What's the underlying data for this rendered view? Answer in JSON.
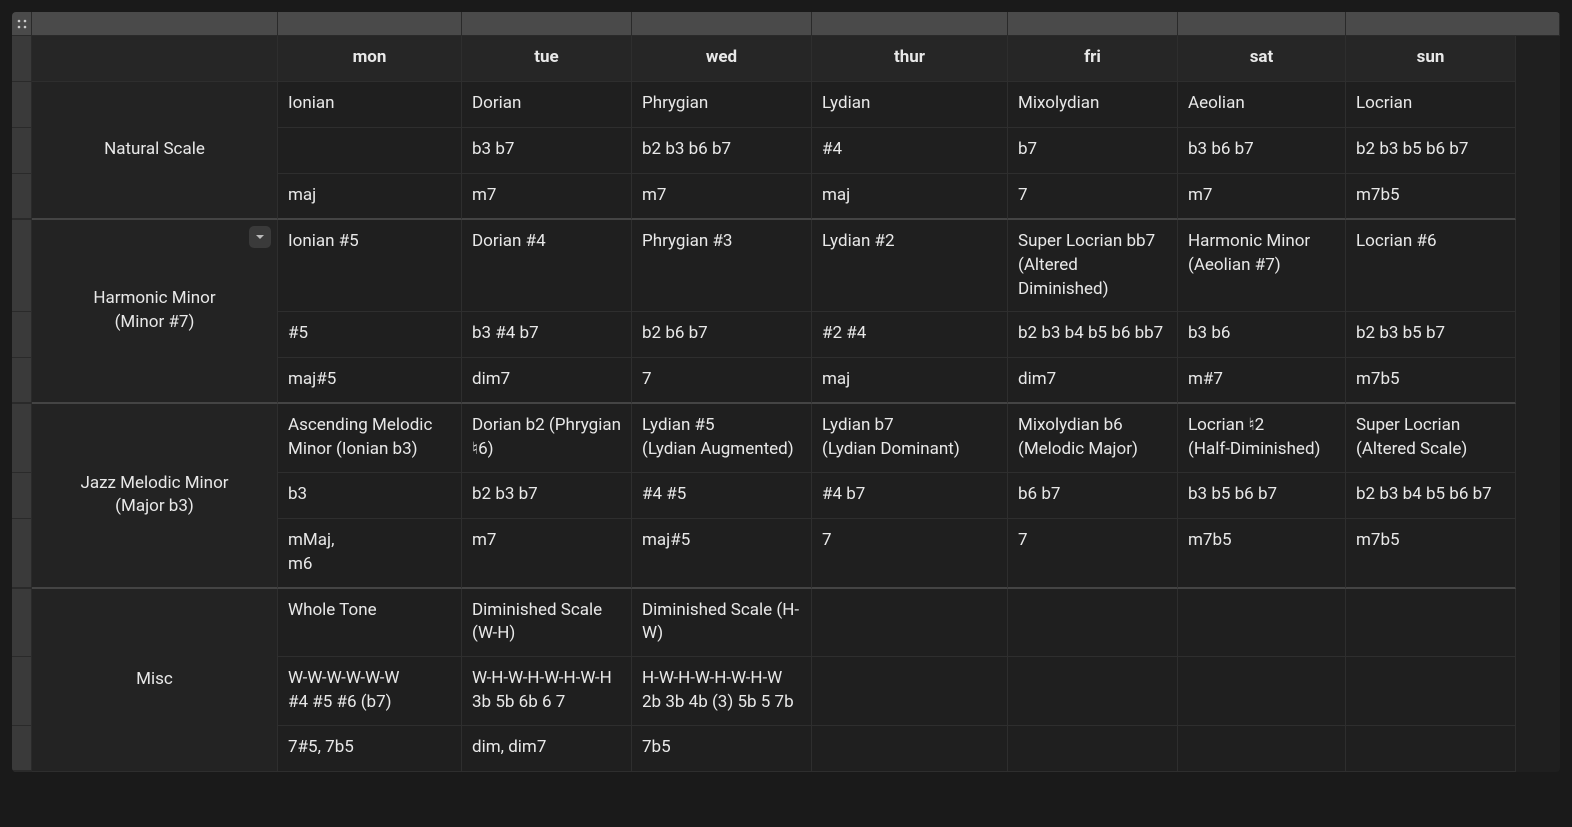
{
  "headers": [
    "mon",
    "tue",
    "wed",
    "thur",
    "fri",
    "sat",
    "sun"
  ],
  "sections": [
    {
      "label": "Natural Scale",
      "has_chevron": false,
      "rows": [
        [
          "Ionian",
          "Dorian",
          "Phrygian",
          "Lydian",
          "Mixolydian",
          "Aeolian",
          "Locrian"
        ],
        [
          "",
          "b3 b7",
          "b2 b3 b6 b7",
          "#4",
          "b7",
          "b3 b6 b7",
          "b2 b3 b5 b6 b7"
        ],
        [
          "maj",
          "m7",
          "m7",
          "maj",
          "7",
          "m7",
          "m7b5"
        ]
      ]
    },
    {
      "label": "Harmonic Minor\n(Minor #7)",
      "has_chevron": true,
      "rows": [
        [
          "Ionian #5",
          "Dorian #4",
          "Phrygian #3",
          "Lydian #2",
          "Super Locrian bb7 (Altered Diminished)",
          "Harmonic Minor (Aeolian #7)",
          "Locrian #6"
        ],
        [
          "#5",
          "b3 #4 b7",
          "b2 b6 b7",
          "#2 #4",
          "b2 b3 b4 b5 b6 bb7",
          "b3 b6",
          "b2 b3 b5 b7"
        ],
        [
          "maj#5",
          "dim7",
          "7",
          "maj",
          "dim7",
          "m#7",
          "m7b5"
        ]
      ]
    },
    {
      "label": "Jazz Melodic Minor\n(Major b3)",
      "has_chevron": false,
      "rows": [
        [
          "Ascending Melodic Minor (Ionian b3)",
          "Dorian b2 (Phrygian ♮6)",
          "Lydian #5\n(Lydian Augmented)",
          "Lydian b7\n(Lydian Dominant)",
          "Mixolydian b6 (Melodic Major)",
          "Locrian ♮2\n(Half-Diminished)",
          "Super Locrian (Altered Scale)"
        ],
        [
          "b3",
          "b2 b3 b7",
          "#4 #5",
          "#4 b7",
          "b6 b7",
          "b3 b5 b6 b7",
          "b2 b3 b4 b5 b6 b7"
        ],
        [
          "mMaj,\nm6",
          "m7",
          "maj#5",
          "7",
          "7",
          "m7b5",
          "m7b5"
        ]
      ]
    },
    {
      "label": "Misc",
      "has_chevron": false,
      "rows": [
        [
          "Whole Tone",
          "Diminished Scale (W-H)",
          "Diminished Scale (H-W)",
          "",
          "",
          "",
          ""
        ],
        [
          "W-W-W-W-W-W\n#4 #5 #6 (b7)",
          "W-H-W-H-W-H-W-H\n3b 5b 6b 6 7",
          "H-W-H-W-H-W-H-W\n2b 3b 4b (3) 5b 5 7b",
          "",
          "",
          "",
          ""
        ],
        [
          "7#5, 7b5",
          "dim, dim7",
          "7b5",
          "",
          "",
          "",
          ""
        ]
      ]
    }
  ]
}
